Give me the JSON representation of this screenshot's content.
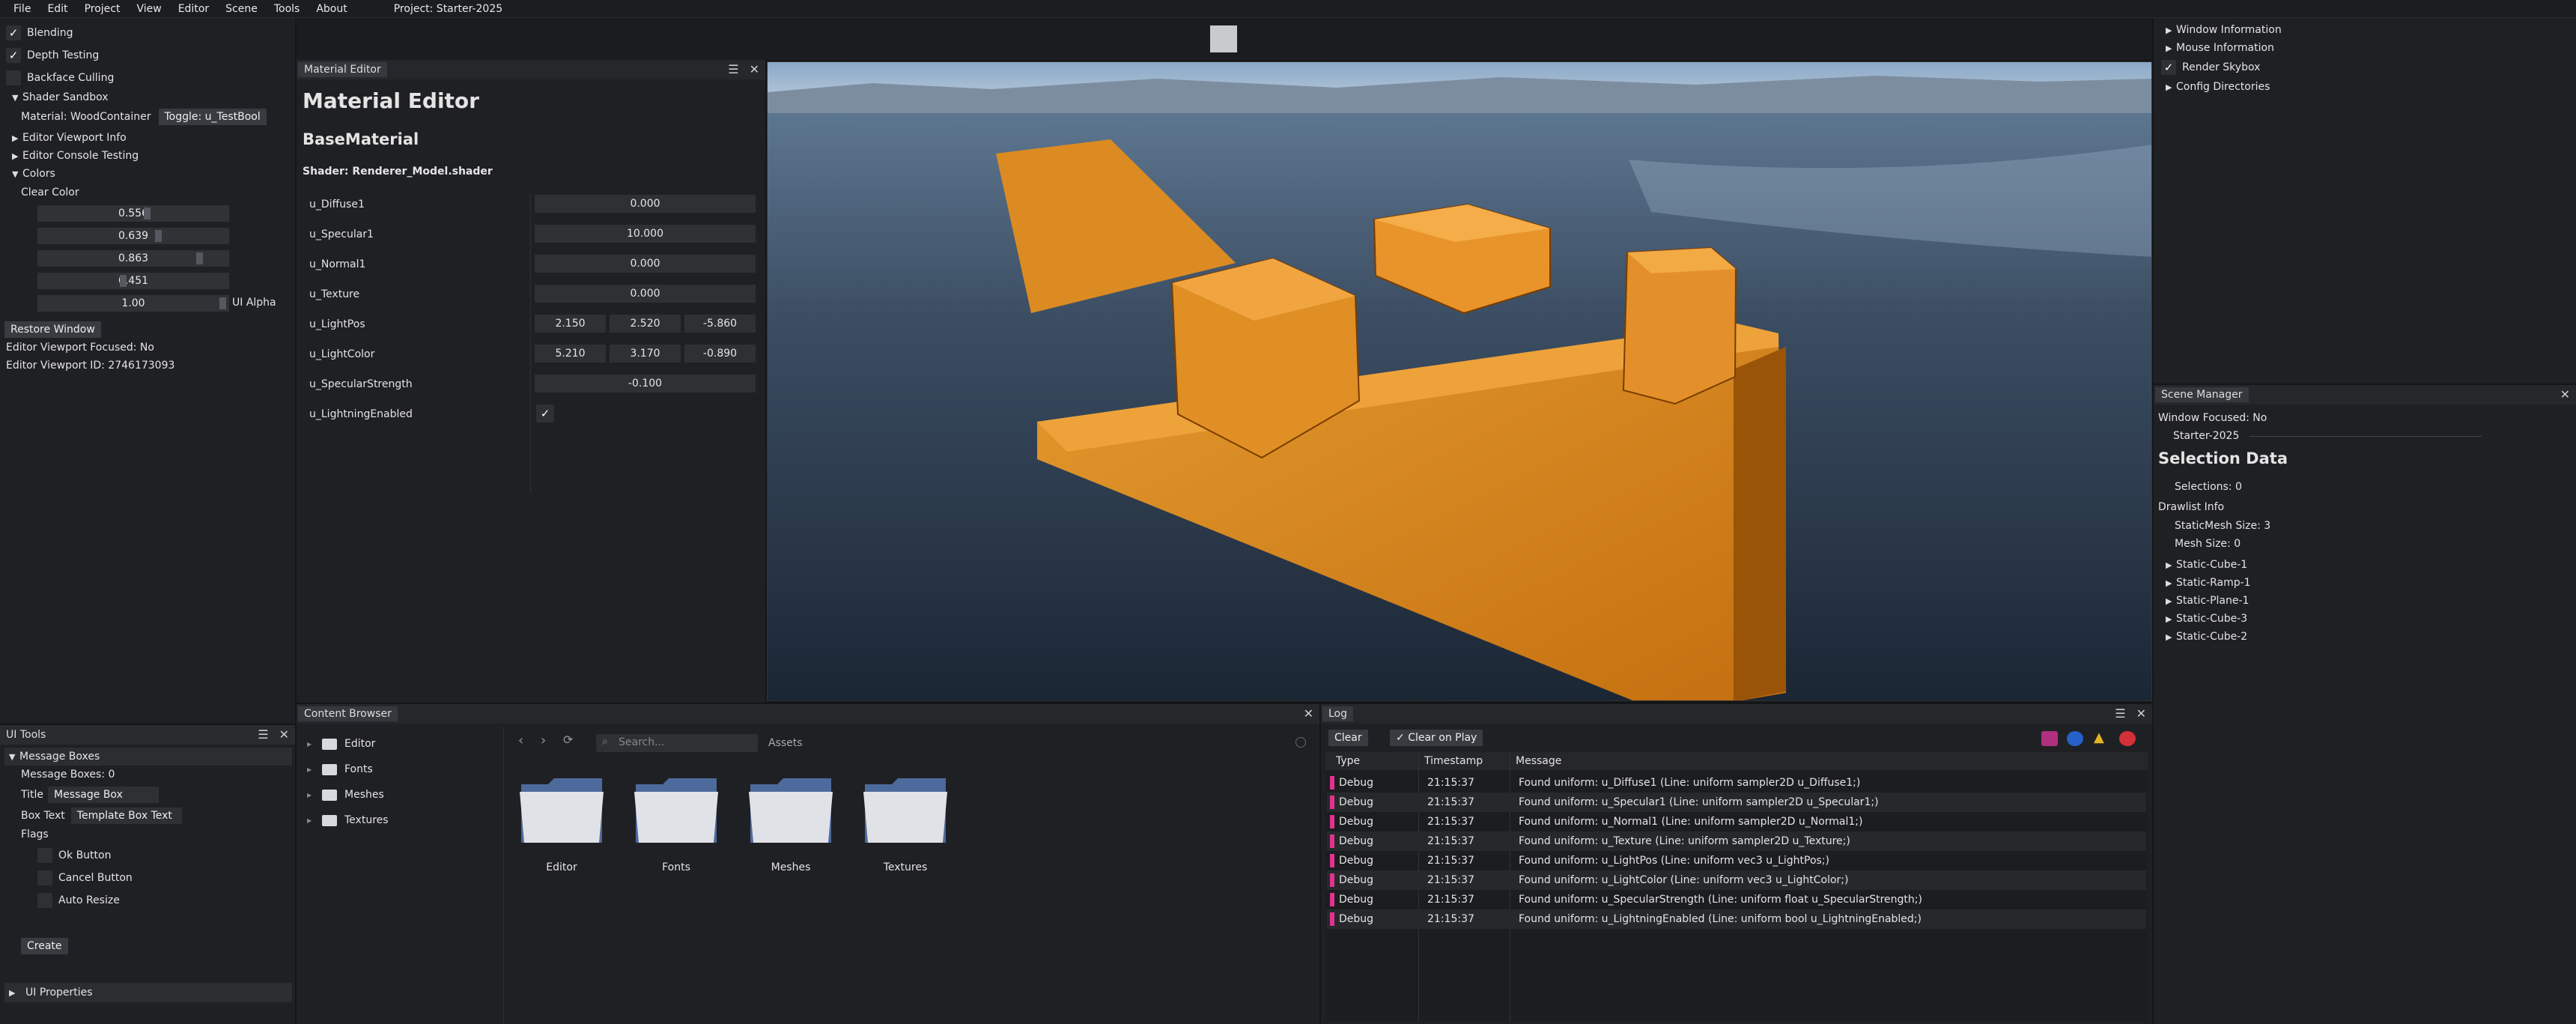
{
  "menu": {
    "items": [
      "File",
      "Edit",
      "Project",
      "View",
      "Editor",
      "Scene",
      "Tools",
      "About"
    ],
    "project": "Project: Starter-2025"
  },
  "left": {
    "blending": "Blending",
    "depth": "Depth Testing",
    "backface": "Backface Culling",
    "shader_sandbox": "Shader Sandbox",
    "material": "Material: WoodContainer",
    "toggle": "Toggle: u_TestBool",
    "viewport_info": "Editor Viewport Info",
    "console_testing": "Editor Console Testing",
    "colors": "Colors",
    "clear_color": "Clear Color",
    "r": "0.556",
    "g": "0.639",
    "b": "0.863",
    "a": "0.451",
    "ui_alpha_val": "1.00",
    "ui_alpha": "UI Alpha",
    "restore": "Restore Window",
    "focused": "Editor Viewport Focused: No",
    "vid": "Editor Viewport ID: 2746173093"
  },
  "ui_tools": {
    "title": "UI Tools",
    "message_boxes": "Message Boxes",
    "count": "Message Boxes: 0",
    "title_lbl": "Title",
    "title_val": "Message Box",
    "box_text_lbl": "Box Text",
    "box_text_val": "Template Box Text",
    "flags": "Flags",
    "ok": "Ok Button",
    "cancel": "Cancel Button",
    "auto": "Auto Resize",
    "create": "Create",
    "props": "UI Properties"
  },
  "material": {
    "tab": "Material Editor",
    "title": "Material Editor",
    "base": "BaseMaterial",
    "shader": "Shader: Renderer_Model.shader",
    "u_diffuse": "u_Diffuse1",
    "u_diffuse_v": "0.000",
    "u_spec": "u_Specular1",
    "u_spec_v": "10.000",
    "u_normal": "u_Normal1",
    "u_normal_v": "0.000",
    "u_texture": "u_Texture",
    "u_texture_v": "0.000",
    "u_lightpos": "u_LightPos",
    "lp1": "2.150",
    "lp2": "2.520",
    "lp3": "-5.860",
    "u_lightcolor": "u_LightColor",
    "lc1": "5.210",
    "lc2": "3.170",
    "lc3": "-0.890",
    "u_specstr": "u_SpecularStrength",
    "u_specstr_v": "-0.100",
    "u_light_en": "u_LightningEnabled"
  },
  "right": {
    "window_info": "Window Information",
    "mouse_info": "Mouse Information",
    "skybox": "Render Skybox",
    "config": "Config Directories"
  },
  "scene": {
    "tab": "Scene Manager",
    "focused": "Window Focused: No",
    "starter": "Starter-2025",
    "selection": "Selection Data",
    "selections": "Selections: 0",
    "drawlist": "Drawlist Info",
    "staticmesh": "StaticMesh Size:  3",
    "meshsize": "Mesh Size:      0",
    "items": [
      "Static-Cube-1",
      "Static-Ramp-1",
      "Static-Plane-1",
      "Static-Cube-3",
      "Static-Cube-2"
    ]
  },
  "content": {
    "tab": "Content Browser",
    "search_placeholder": "Search...",
    "assets": "Assets",
    "folders": [
      "Editor",
      "Fonts",
      "Meshes",
      "Textures"
    ]
  },
  "log": {
    "tab": "Log",
    "clear": "Clear",
    "clear_on_play": "Clear on Play",
    "col_type": "Type",
    "col_ts": "Timestamp",
    "col_msg": "Message",
    "rows": [
      {
        "type": "Debug",
        "ts": "21:15:37",
        "msg": "Found uniform: u_Diffuse1 (Line: uniform sampler2D u_Diffuse1;)"
      },
      {
        "type": "Debug",
        "ts": "21:15:37",
        "msg": "Found uniform: u_Specular1 (Line: uniform sampler2D u_Specular1;)"
      },
      {
        "type": "Debug",
        "ts": "21:15:37",
        "msg": "Found uniform: u_Normal1 (Line: uniform sampler2D u_Normal1;)"
      },
      {
        "type": "Debug",
        "ts": "21:15:37",
        "msg": "Found uniform: u_Texture (Line: uniform sampler2D u_Texture;)"
      },
      {
        "type": "Debug",
        "ts": "21:15:37",
        "msg": "Found uniform: u_LightPos (Line: uniform vec3 u_LightPos;)"
      },
      {
        "type": "Debug",
        "ts": "21:15:37",
        "msg": "Found uniform: u_LightColor (Line: uniform vec3 u_LightColor;)"
      },
      {
        "type": "Debug",
        "ts": "21:15:37",
        "msg": "Found uniform: u_SpecularStrength (Line: uniform float u_SpecularStrength;)"
      },
      {
        "type": "Debug",
        "ts": "21:15:37",
        "msg": "Found uniform: u_LightningEnabled (Line: uniform bool u_LightningEnabled;)"
      }
    ]
  },
  "colors": {
    "accent": "#e0338f",
    "orange": "#e08a1c",
    "panel": "#1f2023"
  }
}
